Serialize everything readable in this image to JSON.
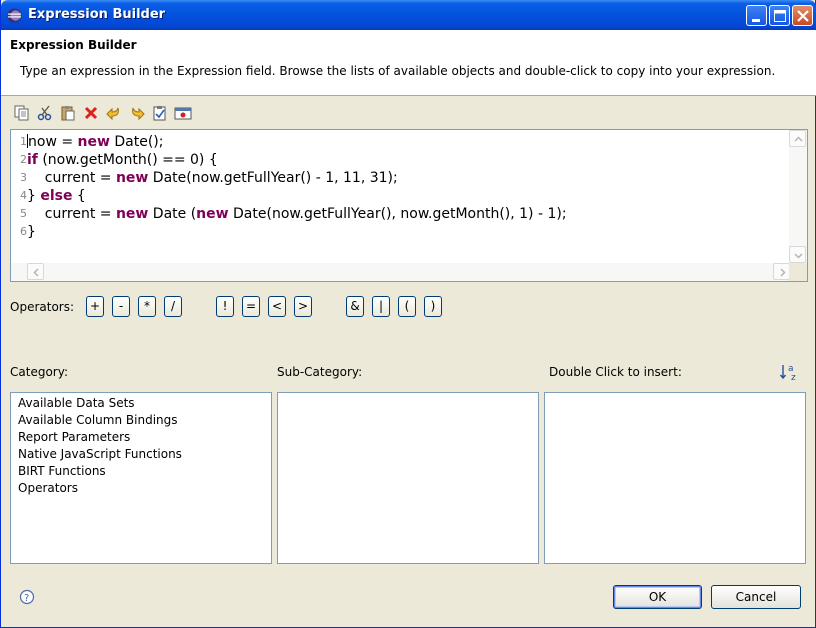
{
  "window": {
    "title": "Expression Builder"
  },
  "header": {
    "title": "Expression Builder",
    "description": "Type an expression in the Expression field. Browse the lists of available objects and double-click to copy into your expression."
  },
  "toolbar": {
    "icons": [
      "copy-icon",
      "cut-icon",
      "paste-icon",
      "delete-icon",
      "undo-icon",
      "redo-icon",
      "validate-icon",
      "preview-icon"
    ]
  },
  "editor": {
    "line_numbers": [
      "1",
      "2",
      "3",
      "4",
      "5",
      "6"
    ],
    "lines": [
      [
        {
          "t": "now = "
        },
        {
          "t": "new",
          "k": true
        },
        {
          "t": " Date();"
        }
      ],
      [
        {
          "t": "if",
          "k": true
        },
        {
          "t": " (now.getMonth() == 0) {"
        }
      ],
      [
        {
          "t": "    current = "
        },
        {
          "t": "new",
          "k": true
        },
        {
          "t": " Date(now.getFullYear() - 1, 11, 31);"
        }
      ],
      [
        {
          "t": "} "
        },
        {
          "t": "else",
          "k": true
        },
        {
          "t": " {"
        }
      ],
      [
        {
          "t": "    current = "
        },
        {
          "t": "new",
          "k": true
        },
        {
          "t": " Date ("
        },
        {
          "t": "new",
          "k": true
        },
        {
          "t": " Date(now.getFullYear(), now.getMonth(), 1) - 1);"
        }
      ],
      [
        {
          "t": "}"
        }
      ]
    ],
    "keyword_color": "#7f0055"
  },
  "operators": {
    "label": "Operators:",
    "items": [
      "+",
      "-",
      "*",
      "/",
      "!",
      "=",
      "<",
      ">",
      "&",
      "|",
      "(",
      ")"
    ]
  },
  "browser": {
    "category_label": "Category:",
    "subcategory_label": "Sub-Category:",
    "insert_label": "Double Click to insert:",
    "categories": [
      "Available Data Sets",
      "Available Column Bindings",
      "Report Parameters",
      "Native JavaScript Functions",
      "BIRT Functions",
      "Operators"
    ]
  },
  "footer": {
    "ok_label": "OK",
    "cancel_label": "Cancel"
  },
  "colors": {
    "titlebar": "#0552de",
    "accent": "#003c74"
  }
}
